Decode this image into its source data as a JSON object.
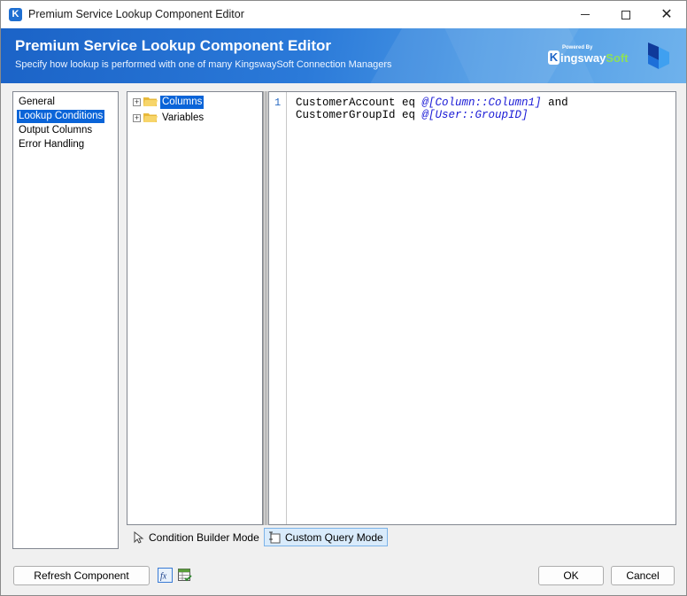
{
  "window": {
    "title": "Premium Service Lookup Component Editor",
    "app_icon_letter": "K"
  },
  "banner": {
    "title": "Premium Service Lookup Component Editor",
    "subtitle": "Specify how lookup is performed with one of many KingswaySoft Connection Managers",
    "brand_powered": "Powered By",
    "brand_k": "K",
    "brand_name_main": "ingsway",
    "brand_name_soft": "Soft"
  },
  "nav": {
    "items": [
      {
        "label": "General",
        "selected": false
      },
      {
        "label": "Lookup Conditions",
        "selected": true
      },
      {
        "label": "Output Columns",
        "selected": false
      },
      {
        "label": "Error Handling",
        "selected": false
      }
    ]
  },
  "tree": {
    "nodes": [
      {
        "label": "Columns",
        "selected": true,
        "icon": "folder-icon"
      },
      {
        "label": "Variables",
        "selected": false,
        "icon": "folder-icon"
      }
    ]
  },
  "editor": {
    "line_number": "1",
    "line1_text": "CustomerAccount eq ",
    "line1_var": "@[Column::Column1]",
    "line1_end": " and",
    "line2_text": "CustomerGroupId eq ",
    "line2_var": "@[User::GroupID]"
  },
  "modes": {
    "builder_label": "Condition Builder Mode",
    "custom_label": "Custom Query Mode",
    "active": "custom"
  },
  "footer": {
    "refresh_label": "Refresh Component",
    "ok_label": "OK",
    "cancel_label": "Cancel"
  },
  "colors": {
    "banner_start": "#1b63c7",
    "selection": "#0a64d8",
    "variable_text": "#1a1ad6",
    "custom_mode_bg": "#d9ebfb"
  }
}
